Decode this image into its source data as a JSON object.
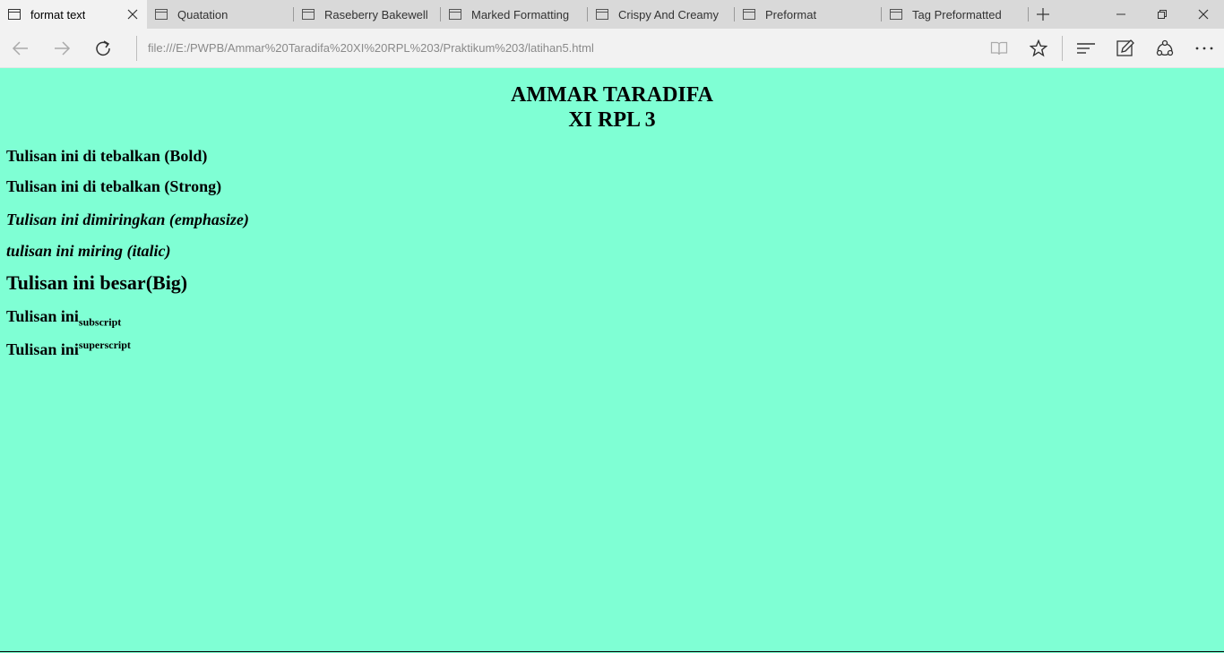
{
  "browser": {
    "tabs": [
      {
        "label": "format text",
        "active": true
      },
      {
        "label": "Quatation",
        "active": false
      },
      {
        "label": "Raseberry Bakewell",
        "active": false
      },
      {
        "label": "Marked Formatting",
        "active": false
      },
      {
        "label": "Crispy And Creamy",
        "active": false
      },
      {
        "label": "Preformat",
        "active": false
      },
      {
        "label": "Tag Preformatted",
        "active": false
      }
    ],
    "address": "file:///E:/PWPB/Ammar%20Taradifa%20XI%20RPL%203/Praktikum%203/latihan5.html",
    "icons": [
      "back-icon",
      "forward-icon",
      "refresh-icon",
      "reading-view-icon",
      "favorite-star-icon",
      "hub-icon",
      "web-note-icon",
      "share-icon",
      "more-icon"
    ]
  },
  "page": {
    "title_line1": "AMMAR TARADIFA",
    "title_line2": "XI RPL 3",
    "bold": "Tulisan ini di tebalkan (Bold)",
    "strong": "Tulisan ini di tebalkan (Strong)",
    "emphasize": "Tulisan ini dimiringkan (emphasize)",
    "italic": "tulisan ini miring (italic)",
    "big": "Tulisan ini besar(Big)",
    "sub_prefix": "Tulisan ini",
    "sub_text": "subscript",
    "sup_prefix": "Tulisan ini",
    "sup_text": "superscript"
  },
  "colors": {
    "page_background": "#7fffd4",
    "tab_strip": "#d9d9d9",
    "toolbar": "#f2f2f2"
  }
}
